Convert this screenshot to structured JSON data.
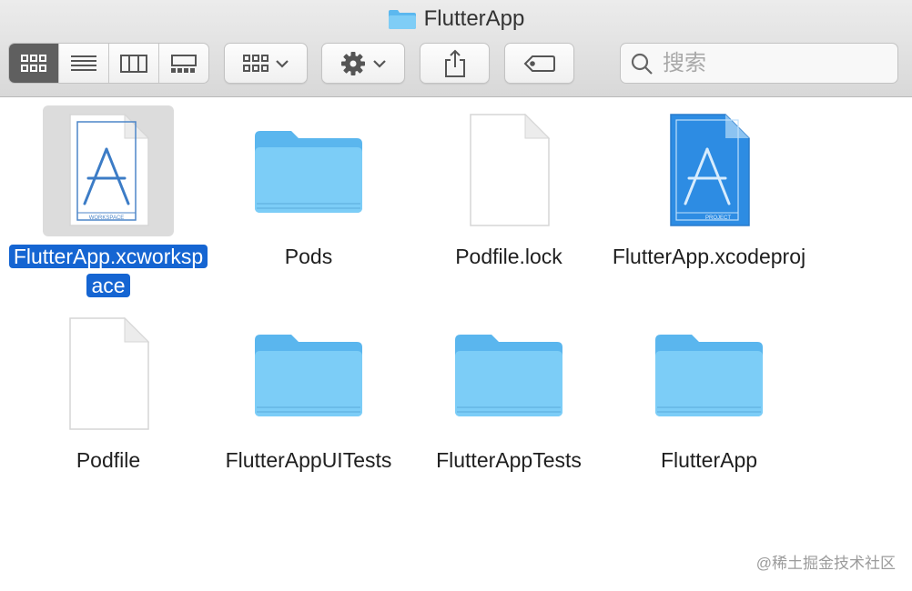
{
  "window": {
    "title": "FlutterApp"
  },
  "toolbar": {
    "view_modes": [
      {
        "name": "icon-view-button",
        "icon": "grid-icon",
        "active": true
      },
      {
        "name": "list-view-button",
        "icon": "list-icon",
        "active": false
      },
      {
        "name": "column-view-button",
        "icon": "columns-icon",
        "active": false
      },
      {
        "name": "gallery-view-button",
        "icon": "gallery-icon",
        "active": false
      }
    ],
    "group_button_icon": "grid-dropdown-icon",
    "action_button_icon": "gear-icon",
    "share_button_icon": "share-icon",
    "tag_button_icon": "tag-icon"
  },
  "search": {
    "placeholder": "搜索",
    "value": ""
  },
  "items": [
    {
      "label": "FlutterApp.xcworkspace",
      "type": "workspace",
      "selected": true,
      "icon_text": "WORKSPACE"
    },
    {
      "label": "Pods",
      "type": "folder",
      "selected": false
    },
    {
      "label": "Podfile.lock",
      "type": "file",
      "selected": false
    },
    {
      "label": "FlutterApp.xcodeproj",
      "type": "project",
      "selected": false,
      "icon_text": "PROJECT"
    },
    {
      "label": "Podfile",
      "type": "file",
      "selected": false
    },
    {
      "label": "FlutterAppUITests",
      "type": "folder",
      "selected": false
    },
    {
      "label": "FlutterAppTests",
      "type": "folder",
      "selected": false
    },
    {
      "label": "FlutterApp",
      "type": "folder",
      "selected": false
    }
  ],
  "watermark": "@稀土掘金技术社区",
  "colors": {
    "folder": "#6cc2f2",
    "selection": "#1565d2",
    "project": "#2d8ce3"
  }
}
